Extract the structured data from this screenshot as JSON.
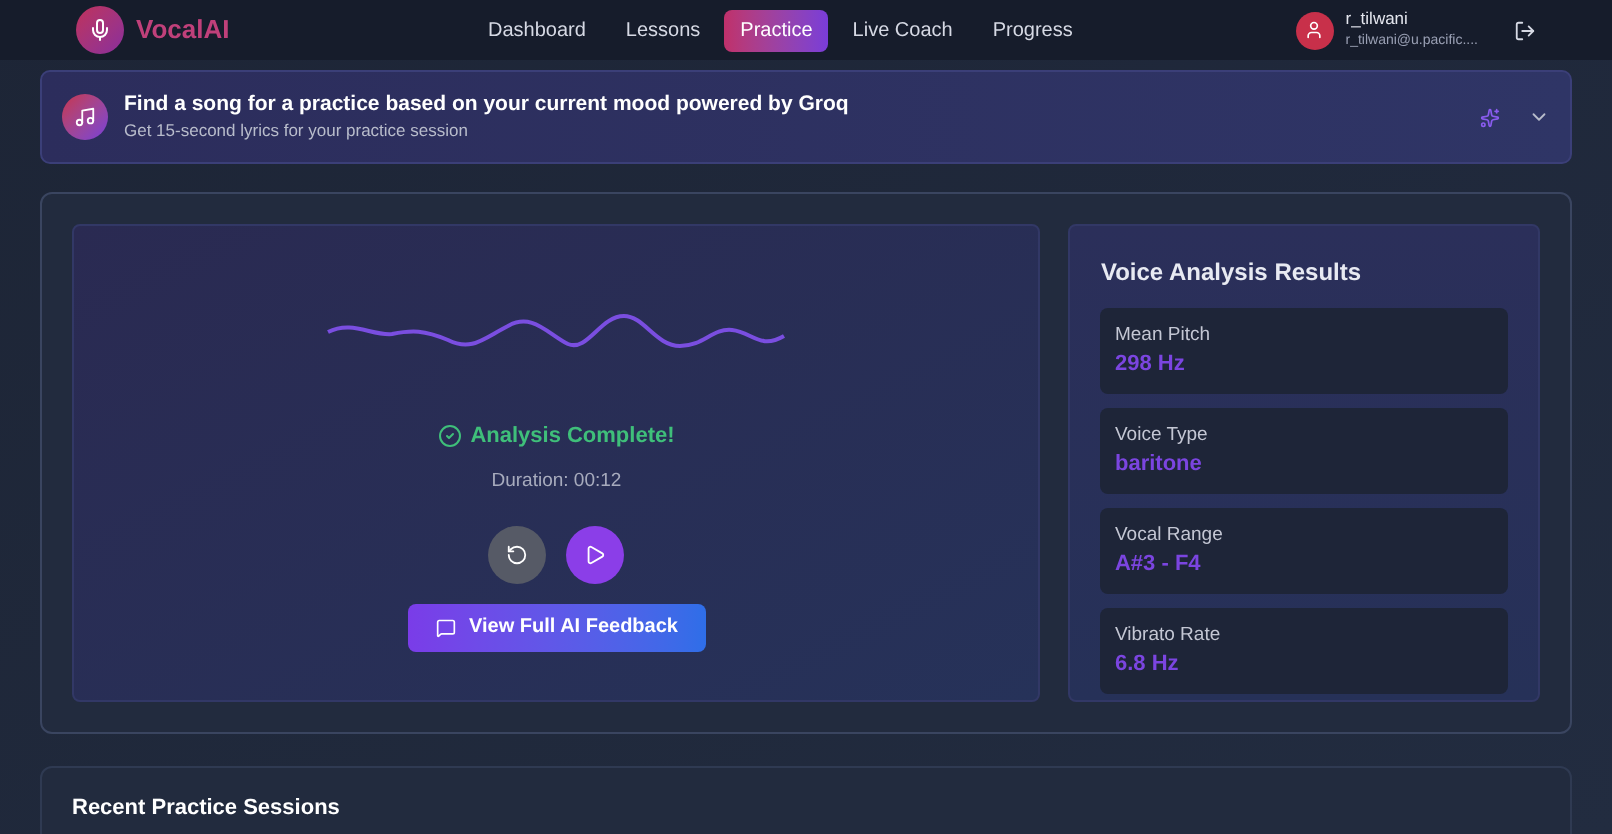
{
  "brand": "VocalAI",
  "nav": [
    {
      "label": "Dashboard",
      "selected": false
    },
    {
      "label": "Lessons",
      "selected": false
    },
    {
      "label": "Practice",
      "selected": true
    },
    {
      "label": "Live Coach",
      "selected": false
    },
    {
      "label": "Progress",
      "selected": false
    }
  ],
  "user": {
    "name": "r_tilwani",
    "email": "r_tilwani@u.pacific...."
  },
  "banner": {
    "title": "Find a song for a practice based on your current mood powered by Groq",
    "subtitle": "Get 15-second lyrics for your practice session",
    "expanded": false
  },
  "recording": {
    "status": "Analysis Complete!",
    "duration": "Duration: 00:12",
    "feedback_button": "View Full AI Feedback"
  },
  "results": {
    "title": "Voice Analysis Results",
    "stats": [
      {
        "label": "Mean Pitch",
        "value": "298 Hz"
      },
      {
        "label": "Voice Type",
        "value": "baritone"
      },
      {
        "label": "Vocal Range",
        "value": "A#3 - F4"
      },
      {
        "label": "Vibrato Rate",
        "value": "6.8 Hz"
      }
    ]
  },
  "recent": {
    "title": "Recent Practice Sessions"
  }
}
